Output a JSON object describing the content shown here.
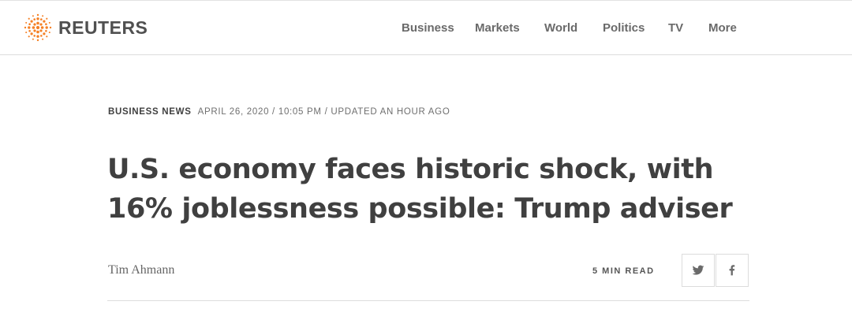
{
  "brand": {
    "name": "REUTERS",
    "accent_color": "#f58025",
    "logo_icon": "reuters-dot-sphere-icon"
  },
  "nav": {
    "items": [
      {
        "label": "Business"
      },
      {
        "label": "Markets"
      },
      {
        "label": "World"
      },
      {
        "label": "Politics"
      },
      {
        "label": "TV"
      },
      {
        "label": "More"
      }
    ]
  },
  "article": {
    "category": "Business News",
    "dateline": "April 26, 2020 / 10:05 PM / Updated an hour ago",
    "headline": "U.S. economy faces historic shock, with 16% joblessness possible: Trump adviser",
    "author": "Tim Ahmann",
    "read_time": "5 Min Read"
  },
  "share": {
    "buttons": [
      {
        "icon": "twitter-icon"
      },
      {
        "icon": "facebook-icon"
      }
    ]
  }
}
